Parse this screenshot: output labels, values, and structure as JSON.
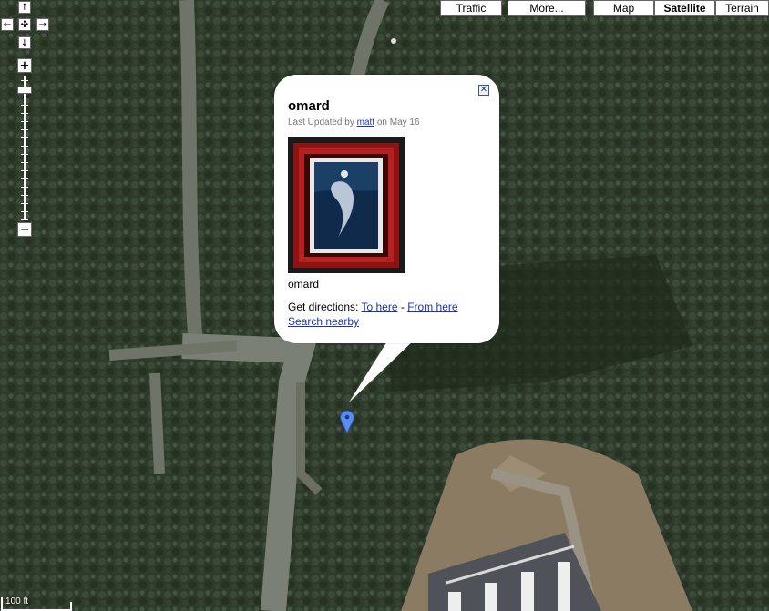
{
  "map": {
    "view": "satellite",
    "layers": {
      "traffic_label": "Traffic",
      "more_label": "More..."
    },
    "map_types": [
      {
        "label": "Map",
        "selected": false
      },
      {
        "label": "Satellite",
        "selected": true
      },
      {
        "label": "Terrain",
        "selected": false
      }
    ],
    "zoom_level_fraction": 0.07,
    "scale": {
      "label": "100 ft"
    }
  },
  "controls": {
    "pan_up": "↑",
    "pan_left": "←",
    "pan_center": "✣",
    "pan_right": "→",
    "pan_down": "↓",
    "zoom_in": "+",
    "zoom_out": "−"
  },
  "info_window": {
    "close": "✕",
    "title": "omard",
    "updated_prefix": "Last Updated by",
    "updated_user": "matt",
    "updated_suffix": "on May 16",
    "caption": "omard",
    "directions_label": "Get directions:",
    "to_here": "To here",
    "separator": "-",
    "from_here": "From here",
    "search_nearby": "Search nearby"
  },
  "colors": {
    "link": "#1a35b4",
    "marker": "#5b8def"
  },
  "icons": {
    "marker": "map-pin-icon",
    "close": "close-icon"
  }
}
